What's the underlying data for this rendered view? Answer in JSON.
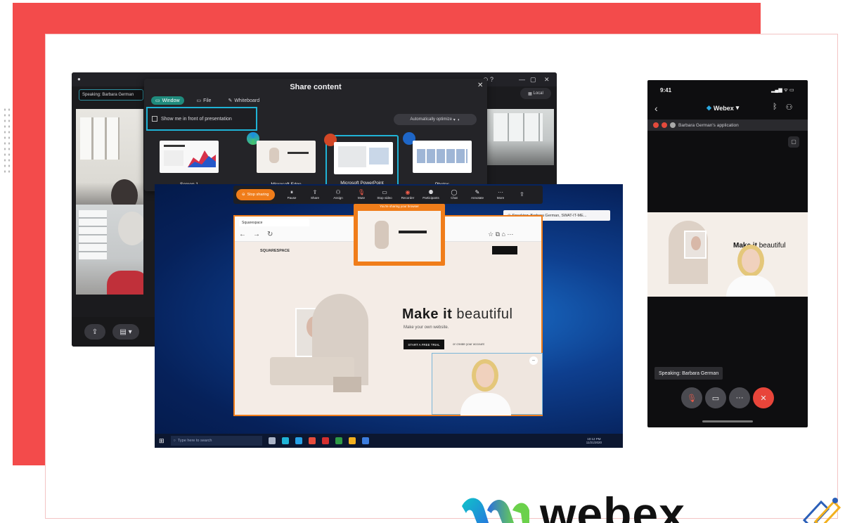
{
  "colors": {
    "brand_red": "#f34b4b",
    "accent_teal": "#1f8b7d",
    "share_orange": "#f07d1a",
    "focus_blue": "#1fb3d6"
  },
  "desktop_app": {
    "speaking_label": "Speaking: Barbara German",
    "search_label": "Local"
  },
  "share_dialog": {
    "title": "Share content",
    "tabs": [
      {
        "label": "Window",
        "icon": "window-icon"
      },
      {
        "label": "File",
        "icon": "file-icon"
      },
      {
        "label": "Whiteboard",
        "icon": "pen-icon"
      }
    ],
    "show_me_label": "Show me in front of presentation",
    "optimize_label": "Automatically optimize",
    "thumbnails": [
      {
        "label": "Screen 1"
      },
      {
        "label": "Microsoft Edge"
      },
      {
        "label": "Microsoft PowerPoint"
      },
      {
        "label": "Photos"
      }
    ]
  },
  "share_toolbar": {
    "stop_label": "Stop sharing",
    "tools": [
      {
        "label": "Pause",
        "icon": "pause-icon"
      },
      {
        "label": "Share",
        "icon": "share-icon"
      },
      {
        "label": "Assign",
        "icon": "assign-icon"
      },
      {
        "label": "Mute",
        "icon": "mic-icon"
      },
      {
        "label": "Stop video",
        "icon": "video-icon"
      },
      {
        "label": "Recorder",
        "icon": "record-icon"
      },
      {
        "label": "Participants",
        "icon": "participants-icon"
      },
      {
        "label": "Chat",
        "icon": "chat-icon"
      },
      {
        "label": "Annotate",
        "icon": "annotate-icon"
      },
      {
        "label": "More",
        "icon": "more-icon"
      }
    ],
    "sharing_notice": "You're sharing your browser",
    "speaking_tip": "Speaking: Barbara German, SWAT-IT-ME..."
  },
  "website": {
    "tab_label": "Squarespace",
    "brand": "SQUARESPACE",
    "headline_bold": "Make it",
    "headline_light": "beautiful",
    "subline": "Make your own website.",
    "cta": "START A FREE TRIAL",
    "secondary": "or create your account"
  },
  "taskbar": {
    "search_placeholder": "Type here to search",
    "clock": "10:12 PM",
    "date": "11/21/2020"
  },
  "phone": {
    "time": "9:41",
    "status": "▂▄▆ ᯤ ▭",
    "title": "Webex",
    "shared_app": "Barbara German's application",
    "share_headline_bold": "Make it",
    "share_headline_light": "beautiful",
    "speaking": "Speaking: Barbara German"
  },
  "logo": {
    "text": "webex"
  }
}
